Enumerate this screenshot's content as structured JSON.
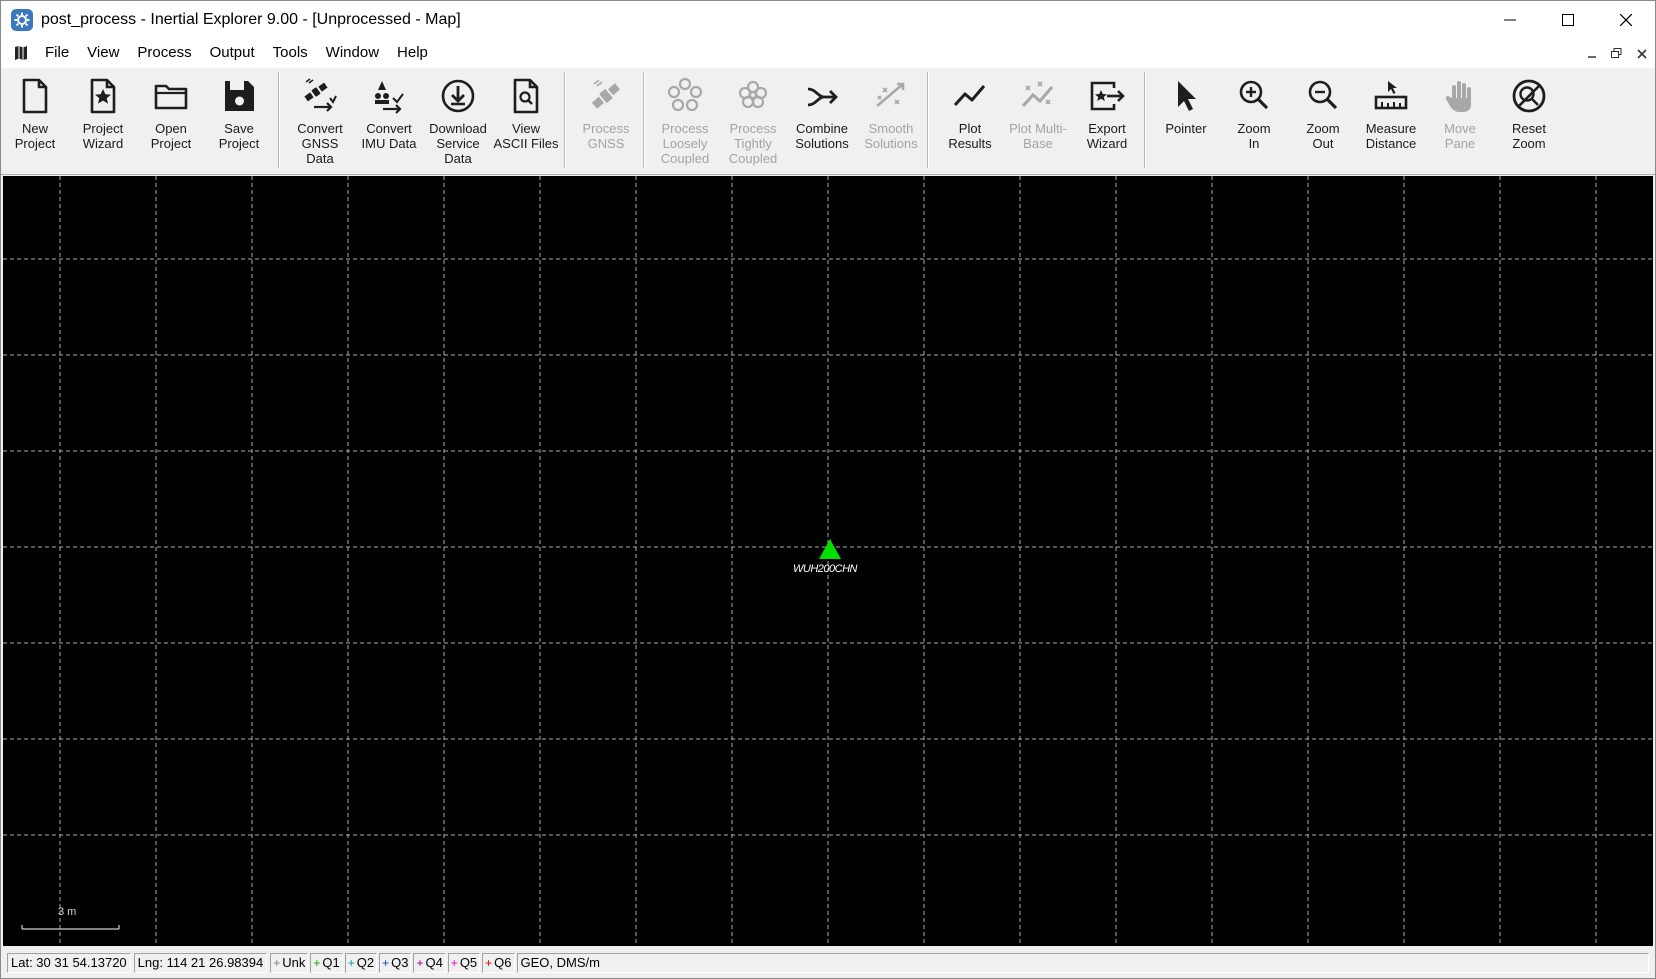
{
  "window": {
    "title": "post_process - Inertial Explorer 9.00 - [Unprocessed - Map]",
    "icon": "app-gear-icon"
  },
  "menu": [
    "File",
    "View",
    "Process",
    "Output",
    "Tools",
    "Window",
    "Help"
  ],
  "toolbar": [
    {
      "label": "New\nProject",
      "icon": "new-file-icon",
      "enabled": true
    },
    {
      "label": "Project\nWizard",
      "icon": "wizard-star-icon",
      "enabled": true
    },
    {
      "label": "Open\nProject",
      "icon": "folder-icon",
      "enabled": true
    },
    {
      "label": "Save\nProject",
      "icon": "floppy-icon",
      "enabled": true
    },
    {
      "label": "Convert\nGNSS\nData",
      "icon": "satellite-convert-icon",
      "enabled": true
    },
    {
      "label": "Convert\nIMU Data",
      "icon": "imu-convert-icon",
      "enabled": true
    },
    {
      "label": "Download\nService\nData",
      "icon": "download-icon",
      "enabled": true
    },
    {
      "label": "View\nASCII Files",
      "icon": "view-file-icon",
      "enabled": true
    },
    {
      "label": "Process\nGNSS",
      "icon": "satellite-process-icon",
      "enabled": false
    },
    {
      "label": "Process\nLoosely\nCoupled",
      "icon": "loose-coupled-icon",
      "enabled": false
    },
    {
      "label": "Process\nTightly\nCoupled",
      "icon": "tight-coupled-icon",
      "enabled": false
    },
    {
      "label": "Combine\nSolutions",
      "icon": "combine-icon",
      "enabled": true
    },
    {
      "label": "Smooth\nSolutions",
      "icon": "smooth-icon",
      "enabled": false
    },
    {
      "label": "Plot\nResults",
      "icon": "line-plot-icon",
      "enabled": true
    },
    {
      "label": "Plot Multi-\nBase",
      "icon": "multi-plot-icon",
      "enabled": false
    },
    {
      "label": "Export\nWizard",
      "icon": "export-icon",
      "enabled": true
    },
    {
      "label": "Pointer",
      "icon": "pointer-icon",
      "enabled": true
    },
    {
      "label": "Zoom\nIn",
      "icon": "zoom-in-icon",
      "enabled": true
    },
    {
      "label": "Zoom\nOut",
      "icon": "zoom-out-icon",
      "enabled": true
    },
    {
      "label": "Measure\nDistance",
      "icon": "ruler-icon",
      "enabled": true
    },
    {
      "label": "Move\nPane",
      "icon": "hand-icon",
      "enabled": false
    },
    {
      "label": "Reset\nZoom",
      "icon": "reset-zoom-icon",
      "enabled": true
    }
  ],
  "map": {
    "background": "#000000",
    "grid_color": "#c8c8c8",
    "station": {
      "label": "WUH200CHN",
      "color": "#00e000"
    },
    "scale_label": "3 m"
  },
  "status": {
    "lat": "Lat: 30 31 54.13720",
    "lng": "Lng: 114 21 26.98394",
    "quality": [
      {
        "label": "Unk",
        "color": "#808080"
      },
      {
        "label": "Q1",
        "color": "#00b000"
      },
      {
        "label": "Q2",
        "color": "#00a0a0"
      },
      {
        "label": "Q3",
        "color": "#0050e0"
      },
      {
        "label": "Q4",
        "color": "#a000a0"
      },
      {
        "label": "Q5",
        "color": "#e000e0"
      },
      {
        "label": "Q6",
        "color": "#e00000"
      }
    ],
    "coord_system": "GEO, DMS/m"
  }
}
